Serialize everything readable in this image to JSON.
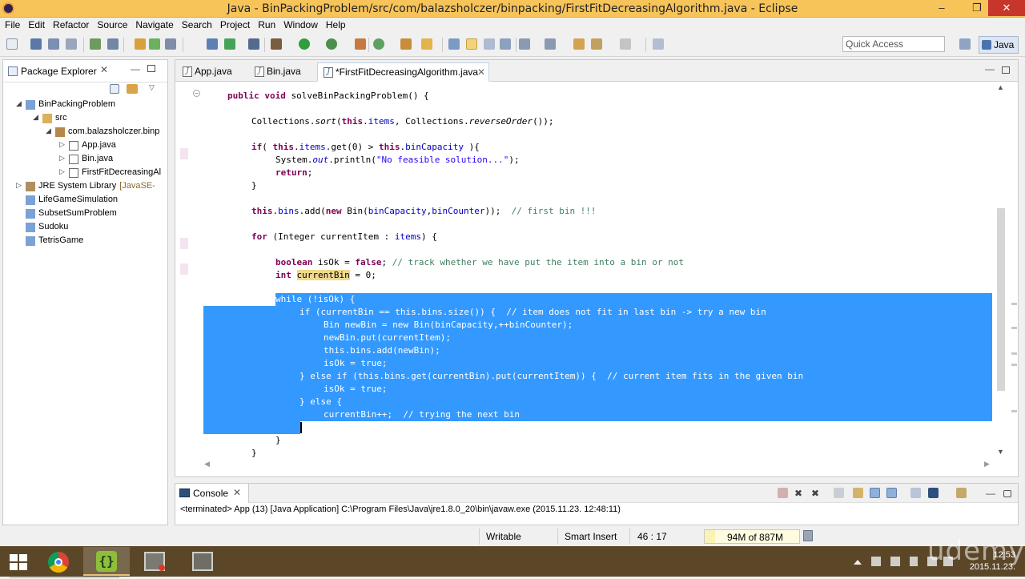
{
  "window": {
    "title": "Java - BinPackingProblem/src/com/balazsholczer/binpacking/FirstFitDecreasingAlgorithm.java - Eclipse",
    "minimize": "–",
    "restore": "❐",
    "close": "✕"
  },
  "menu": [
    "File",
    "Edit",
    "Refactor",
    "Source",
    "Navigate",
    "Search",
    "Project",
    "Run",
    "Window",
    "Help"
  ],
  "toolbar": {
    "quick_access_placeholder": "Quick Access",
    "perspective_label": "Java",
    "accent_color": "#3399ff"
  },
  "package_explorer": {
    "title": "Package Explorer",
    "close": "✕",
    "minimize": "—",
    "tree": [
      {
        "label": "BinPackingProblem",
        "suffix": "",
        "icon": "project-folder-icon",
        "expanded": true
      },
      {
        "label": "src",
        "suffix": "",
        "icon": "source-folder-icon",
        "expanded": true
      },
      {
        "label": "com.balazsholczer.binp",
        "suffix": "",
        "icon": "package-icon",
        "expanded": true
      },
      {
        "label": "App.java",
        "suffix": "",
        "icon": "java-file-icon",
        "expanded": false
      },
      {
        "label": "Bin.java",
        "suffix": "",
        "icon": "java-file-icon",
        "expanded": false
      },
      {
        "label": "FirstFitDecreasingAl",
        "suffix": "",
        "icon": "java-file-icon",
        "expanded": false
      },
      {
        "label": "JRE System Library",
        "suffix": "[JavaSE-",
        "icon": "library-icon",
        "expanded": false
      },
      {
        "label": "LifeGameSimulation",
        "suffix": "",
        "icon": "project-folder-icon",
        "expanded": false
      },
      {
        "label": "SubsetSumProblem",
        "suffix": "",
        "icon": "project-folder-icon",
        "expanded": false
      },
      {
        "label": "Sudoku",
        "suffix": "",
        "icon": "project-folder-icon",
        "expanded": false
      },
      {
        "label": "TetrisGame",
        "suffix": "",
        "icon": "project-folder-icon",
        "expanded": false
      }
    ]
  },
  "editor": {
    "tabs": [
      {
        "label": "App.java",
        "active": false
      },
      {
        "label": "Bin.java",
        "active": false
      },
      {
        "label": "*FirstFitDecreasingAlgorithm.java",
        "active": true
      }
    ],
    "lines": {
      "l1": "public void solveBinPackingProblem() {",
      "l2a": "Collections.",
      "l2b": "sort",
      "l2c": "(",
      "l2d": "this",
      "l2e": ".",
      "l2f": "items",
      "l2g": ", Collections.",
      "l2h": "reverseOrder",
      "l2i": "());",
      "l3": "if( this.items.get(0) > this.binCapacity ){",
      "l4a": "System.",
      "l4b": "out",
      "l4c": ".println(",
      "l4d": "\"No feasible solution...\"",
      "l4e": ");",
      "l5": "return;",
      "l6": "}",
      "l7a": "this",
      "l7b": ".",
      "l7c": "bins",
      "l7d": ".add(",
      "l7e": "new",
      "l7f": " Bin(",
      "l7g": "binCapacity",
      "l7h": ",",
      "l7i": "binCounter",
      "l7j": "));  ",
      "l7k": "// first bin !!!",
      "l8a": "for",
      "l8b": " (Integer currentItem : ",
      "l8c": "items",
      "l8d": ") {",
      "l9a": "boolean",
      "l9b": " isOk = ",
      "l9c": "false",
      "l9d": "; ",
      "l9e": "// track whether we have put the item into a bin or not",
      "l10a": "int",
      "l10b": " ",
      "l10c": "currentBin",
      "l10d": " = 0;",
      "s1": "while (!isOk) {",
      "s2": "if (currentBin == this.bins.size()) {  // item does not fit in last bin -> try a new bin",
      "s3": "Bin newBin = new Bin(binCapacity,++binCounter);",
      "s4": "newBin.put(currentItem);",
      "s5": "this.bins.add(newBin);",
      "s6": "isOk = true;",
      "s7": "} else if (this.bins.get(currentBin).put(currentItem)) {  // current item fits in the given bin",
      "s8": "isOk = true;",
      "s9": "} else {",
      "s10": "currentBin++;  // trying the next bin",
      "e1": "}",
      "e2": "}"
    }
  },
  "console": {
    "title": "Console",
    "close": "✕",
    "output": "<terminated> App (13) [Java Application] C:\\Program Files\\Java\\jre1.8.0_20\\bin\\javaw.exe (2015.11.23. 12:48:11)"
  },
  "status": {
    "writable": "Writable",
    "insert_mode": "Smart Insert",
    "position": "46 : 17",
    "heap": "94M of 887M",
    "heap_used_fraction": 0.106
  },
  "taskbar": {
    "time": "12:53",
    "date": "2015.11.23."
  },
  "watermark": "udemy"
}
